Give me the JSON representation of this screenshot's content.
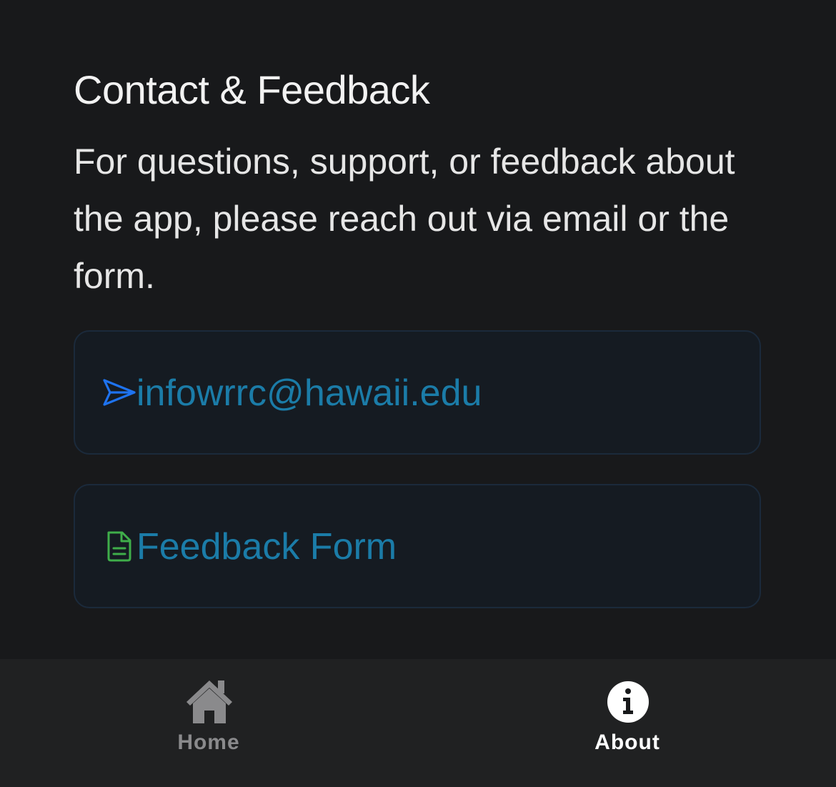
{
  "contact": {
    "title": "Contact & Feedback",
    "description": "For questions, support, or feedback about the app, please reach out via email or the form.",
    "email_label": "infowrrc@hawaii.edu",
    "email_icon": "send-icon",
    "form_label": "Feedback Form",
    "form_icon": "document-icon"
  },
  "tabs": [
    {
      "label": "Home",
      "icon": "home-icon",
      "active": false
    },
    {
      "label": "About",
      "icon": "info-icon",
      "active": true
    }
  ],
  "colors": {
    "background": "#18191b",
    "card_background": "#151b22",
    "card_border": "#1b2a3b",
    "link_text": "#1b7ca8",
    "send_icon": "#1e73f0",
    "document_icon": "#3fae4a",
    "tab_bar": "#202122",
    "tab_inactive": "#8a8a8c",
    "tab_active": "#ffffff"
  }
}
